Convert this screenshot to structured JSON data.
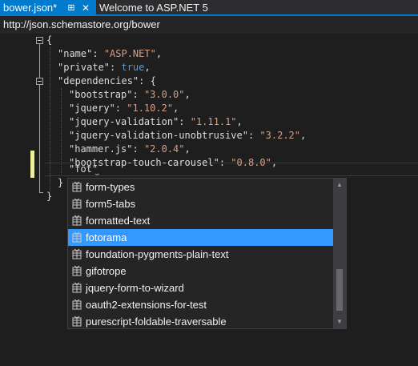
{
  "tabs": [
    {
      "label": "bower.json*",
      "pin_icon": "pin-icon",
      "close_icon": "close-icon"
    },
    {
      "label": "Welcome to ASP.NET 5"
    }
  ],
  "schema_url": "http://json.schemastore.org/bower",
  "colors": {
    "accent": "#007acc",
    "selection": "#3399ff",
    "string": "#d69d85",
    "keyword": "#569cd6",
    "change_marker": "#efefa0"
  },
  "code": {
    "l0": "{",
    "l1_key": "\"name\"",
    "l1_val": "\"ASP.NET\"",
    "l2_key": "\"private\"",
    "l2_val": "true",
    "l3_key": "\"dependencies\"",
    "l3_rest": "{",
    "deps": [
      {
        "key": "\"bootstrap\"",
        "val": "\"3.0.0\""
      },
      {
        "key": "\"jquery\"",
        "val": "\"1.10.2\""
      },
      {
        "key": "\"jquery-validation\"",
        "val": "\"1.11.1\""
      },
      {
        "key": "\"jquery-validation-unobtrusive\"",
        "val": "\"3.2.2\""
      },
      {
        "key": "\"hammer.js\"",
        "val": "\"2.0.4\""
      },
      {
        "key": "\"bootstrap-touch-carousel\"",
        "val": "\"0.8.0\""
      }
    ],
    "typing": "\"fot\"",
    "close_inner": "}",
    "close_outer": "}"
  },
  "completion": {
    "items": [
      "form-types",
      "form5-tabs",
      "formatted-text",
      "fotorama",
      "foundation-pygments-plain-text",
      "gifotrope",
      "jquery-form-to-wizard",
      "oauth2-extensions-for-test",
      "purescript-foldable-traversable"
    ],
    "selected": "fotorama",
    "item_icon": "package-icon"
  }
}
